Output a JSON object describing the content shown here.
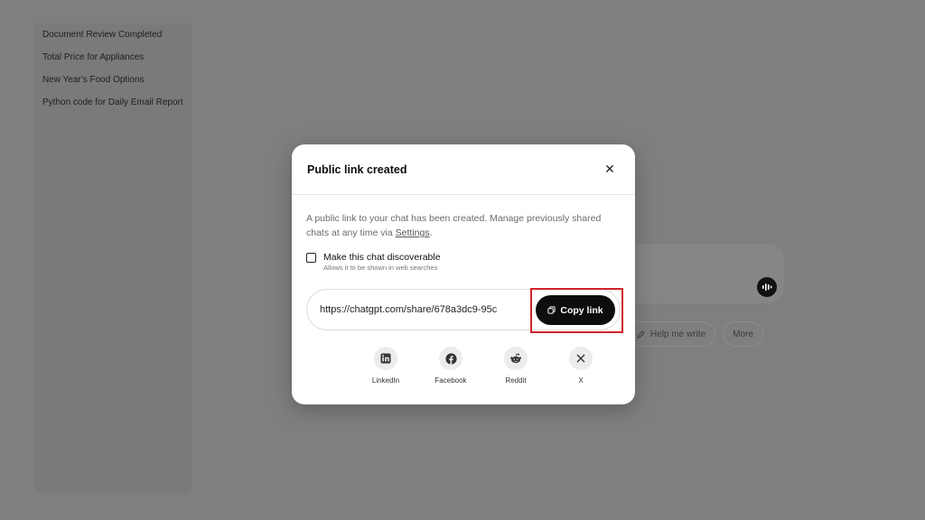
{
  "sidebar": {
    "items": [
      {
        "label": "Document Review Completed"
      },
      {
        "label": "Total Price for Appliances"
      },
      {
        "label": "New Year's Food Options"
      },
      {
        "label": "Python code for Daily Email Report"
      }
    ]
  },
  "suggestions": [
    {
      "label": "Help me write",
      "icon": "pencil-icon"
    },
    {
      "label": "More"
    }
  ],
  "modal": {
    "title": "Public link created",
    "close_icon": "close-icon",
    "description": "A public link to your chat has been created. Manage previously shared chats at any time via ",
    "settings_link": "Settings",
    "description_end": ".",
    "discoverable_label": "Make this chat discoverable",
    "discoverable_sub": "Allows it to be shown in web searches",
    "discoverable_checked": false,
    "link_url": "https://chatgpt.com/share/678a3dc9-95c",
    "copy_label": "Copy link",
    "share_options": [
      {
        "label": "LinkedIn",
        "icon": "linkedin-icon"
      },
      {
        "label": "Facebook",
        "icon": "facebook-icon"
      },
      {
        "label": "Reddit",
        "icon": "reddit-icon"
      },
      {
        "label": "X",
        "icon": "x-icon"
      }
    ]
  },
  "colors": {
    "overlay": "#7f7f7f",
    "modal_bg": "#ffffff",
    "button_dark": "#0d0d0d",
    "highlight": "#d0222c"
  }
}
